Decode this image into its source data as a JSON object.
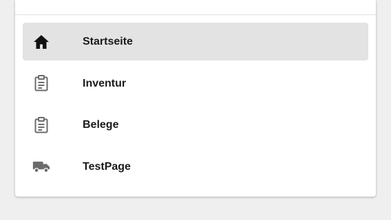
{
  "nav": {
    "items": [
      {
        "label": "Startseite",
        "icon": "home-icon",
        "active": true
      },
      {
        "label": "Inventur",
        "icon": "clipboard-icon",
        "active": false
      },
      {
        "label": "Belege",
        "icon": "clipboard-icon",
        "active": false
      },
      {
        "label": "TestPage",
        "icon": "truck-icon",
        "active": false
      }
    ]
  },
  "colors": {
    "background": "#efefef",
    "panel": "#ffffff",
    "active_item": "#e3e3e3",
    "icon_active": "#111111",
    "icon_inactive": "#6b6b6b",
    "text": "#1a1a1a"
  }
}
